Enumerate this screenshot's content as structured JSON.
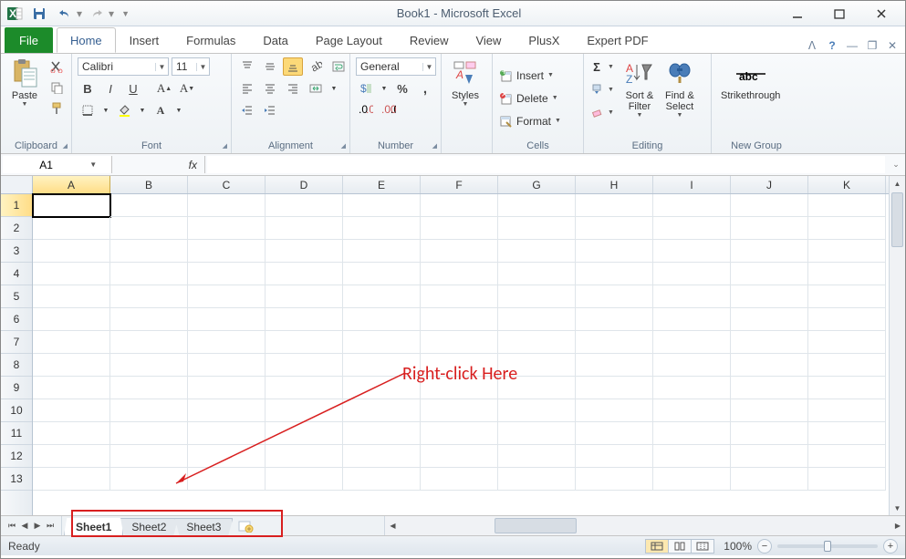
{
  "title": "Book1 - Microsoft Excel",
  "qat": {
    "save": "💾",
    "undo": "↶",
    "redo": "↷"
  },
  "tabs": {
    "file": "File",
    "items": [
      "Home",
      "Insert",
      "Formulas",
      "Data",
      "Page Layout",
      "Review",
      "View",
      "PlusX",
      "Expert PDF"
    ],
    "active": "Home"
  },
  "ribbon": {
    "clipboard": {
      "label": "Clipboard",
      "paste": "Paste"
    },
    "font": {
      "label": "Font",
      "name": "Calibri",
      "size": "11",
      "bold": "B",
      "italic": "I",
      "underline": "U"
    },
    "alignment": {
      "label": "Alignment"
    },
    "number": {
      "label": "Number",
      "format": "General"
    },
    "styles": {
      "label": "Styles",
      "btn": "Styles"
    },
    "cells": {
      "label": "Cells",
      "insert": "Insert",
      "delete": "Delete",
      "format": "Format"
    },
    "editing": {
      "label": "Editing",
      "sort": "Sort &\nFilter",
      "find": "Find &\nSelect"
    },
    "newgroup": {
      "label": "New Group",
      "strike": "Strikethrough"
    }
  },
  "name_box": "A1",
  "fx": "fx",
  "columns": [
    "A",
    "B",
    "C",
    "D",
    "E",
    "F",
    "G",
    "H",
    "I",
    "J",
    "K"
  ],
  "rows": [
    "1",
    "2",
    "3",
    "4",
    "5",
    "6",
    "7",
    "8",
    "9",
    "10",
    "11",
    "12",
    "13"
  ],
  "selected_cell": "A1",
  "annotation": "Right-click Here",
  "sheets": {
    "items": [
      "Sheet1",
      "Sheet2",
      "Sheet3"
    ],
    "active": "Sheet1"
  },
  "status": "Ready",
  "zoom": "100%"
}
